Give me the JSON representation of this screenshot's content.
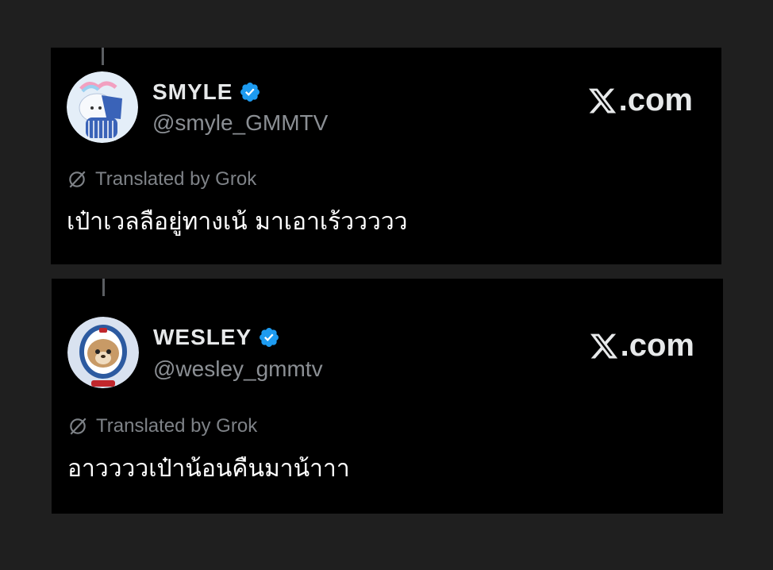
{
  "posts": [
    {
      "name": "SMYLE",
      "handle": "@smyle_GMMTV",
      "source_label": ".com",
      "translation_note": "Translated by Grok",
      "text": "เป๋าเวลลือยู่ทางเน้ มาเอาเร้ววววว",
      "avatar_colors": {
        "bg": "#e4eef8",
        "accent": "#3a63b8"
      }
    },
    {
      "name": "WESLEY",
      "handle": "@wesley_gmmtv",
      "source_label": ".com",
      "translation_note": "Translated by Grok",
      "text": "อาววววเป๋าน้อนคืนมาน้าาา",
      "avatar_colors": {
        "bg": "#d9e2f0",
        "accent": "#2c5aa0"
      }
    }
  ],
  "colors": {
    "page_bg": "#1f1f1f",
    "card_bg": "#000000",
    "verified_badge": "#1d9bf0",
    "muted_text": "#8b8f94"
  },
  "icons": [
    "verified-badge-icon",
    "x-logo-icon",
    "grok-icon"
  ]
}
